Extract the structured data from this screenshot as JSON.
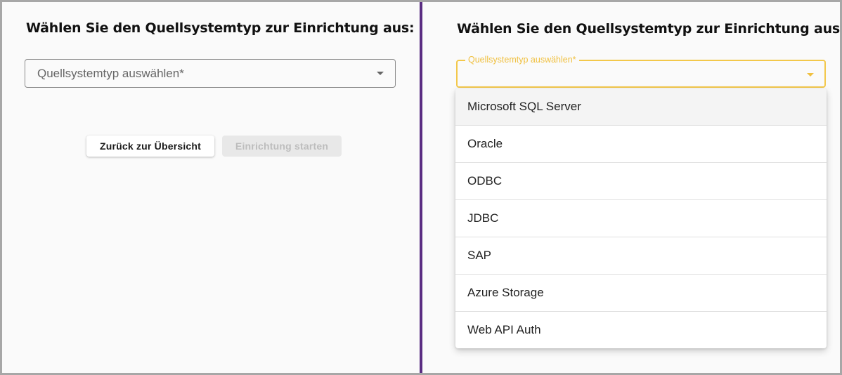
{
  "left_panel": {
    "title": "Wählen Sie den Quellsystemtyp zur Einrichtung aus:",
    "select": {
      "placeholder": "Quellsystemtyp auswählen*",
      "icon": "chevron-down-icon"
    },
    "buttons": {
      "back_label": "Zurück zur Übersicht",
      "start_label": "Einrichtung starten",
      "start_disabled": true
    }
  },
  "right_panel": {
    "title": "Wählen Sie den Quellsystemtyp zur Einrichtung aus:",
    "select": {
      "floating_label": "Quellsystemtyp auswählen*",
      "value": "",
      "icon": "chevron-down-icon",
      "focused": true
    },
    "options": [
      {
        "label": "Microsoft SQL Server",
        "highlighted": true
      },
      {
        "label": "Oracle",
        "highlighted": false
      },
      {
        "label": "ODBC",
        "highlighted": false
      },
      {
        "label": "JDBC",
        "highlighted": false
      },
      {
        "label": "SAP",
        "highlighted": false
      },
      {
        "label": "Azure Storage",
        "highlighted": false
      },
      {
        "label": "Web API Auth",
        "highlighted": false
      }
    ]
  },
  "colors": {
    "divider": "#5a2d82",
    "focus_accent": "#f3c84b",
    "background": "#fafafa"
  }
}
